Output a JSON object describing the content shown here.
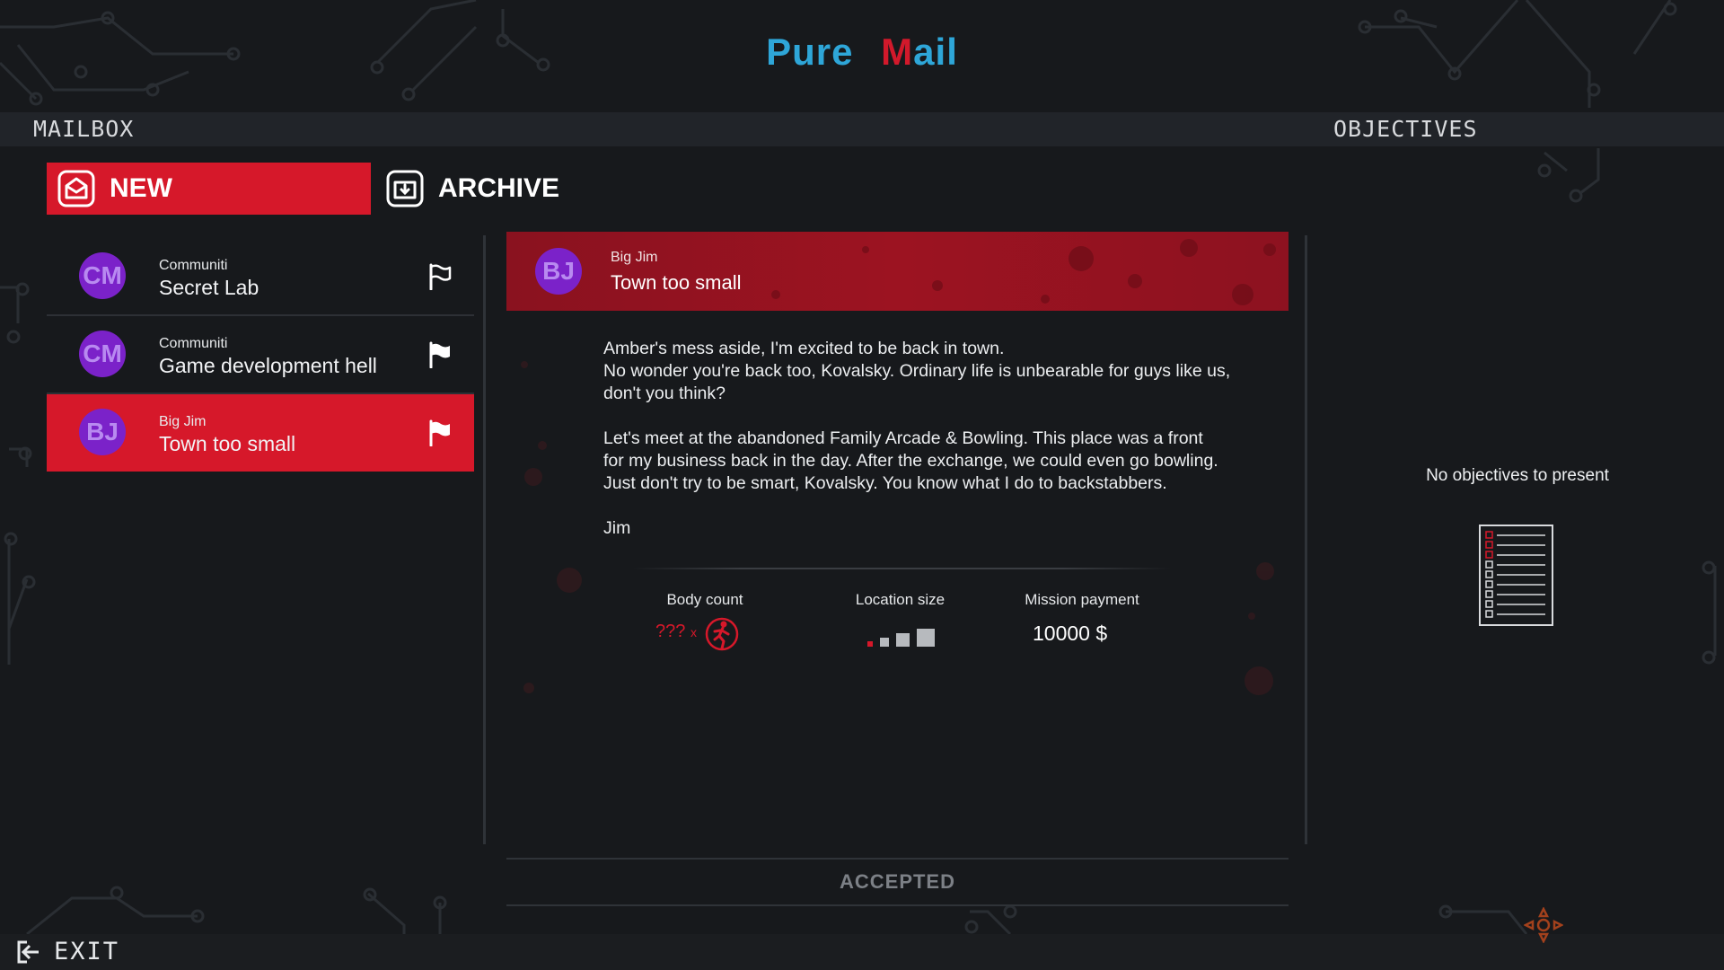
{
  "app": {
    "logo_part1": "Pure",
    "logo_m": "M",
    "logo_part2": "ail"
  },
  "topbar": {
    "left_label": "MAILBOX",
    "right_label": "OBJECTIVES"
  },
  "tabs": {
    "new_label": "NEW",
    "archive_label": "ARCHIVE"
  },
  "mails": [
    {
      "initials": "CM",
      "from": "Communiti",
      "subject": "Secret Lab",
      "flag": "outline"
    },
    {
      "initials": "CM",
      "from": "Communiti",
      "subject": "Game development hell",
      "flag": "filled"
    },
    {
      "initials": "BJ",
      "from": "Big Jim",
      "subject": "Town too small",
      "flag": "filled"
    }
  ],
  "message": {
    "initials": "BJ",
    "from": "Big Jim",
    "subject": "Town too small",
    "paragraph1_line1": "Amber's mess aside, I'm excited to be back in town.",
    "paragraph1_line2": "No wonder you're back too, Kovalsky. Ordinary life is unbearable for guys like us,",
    "paragraph1_line3": "don't you think?",
    "paragraph2_line1": "Let's meet at the abandoned Family Arcade & Bowling. This place was a front",
    "paragraph2_line2": "for my business back in the day. After the exchange, we could even go bowling.",
    "paragraph2_line3": "Just don't try to be smart, Kovalsky. You know what I do to backstabbers.",
    "signature": "Jim"
  },
  "stats": {
    "body_count_label": "Body count",
    "body_count_value": "???",
    "body_count_x": "x",
    "location_size_label": "Location size",
    "location_size_level": 1,
    "location_size_max": 3,
    "mission_payment_label": "Mission payment",
    "mission_payment_value": "10000 $"
  },
  "status": {
    "accepted_label": "ACCEPTED"
  },
  "objectives": {
    "empty_text": "No objectives to present"
  },
  "footer": {
    "exit_label": "EXIT"
  },
  "colors": {
    "accent_red": "#d6182a",
    "logo_blue": "#2ea6d8",
    "avatar_purple": "#7b22c9"
  }
}
